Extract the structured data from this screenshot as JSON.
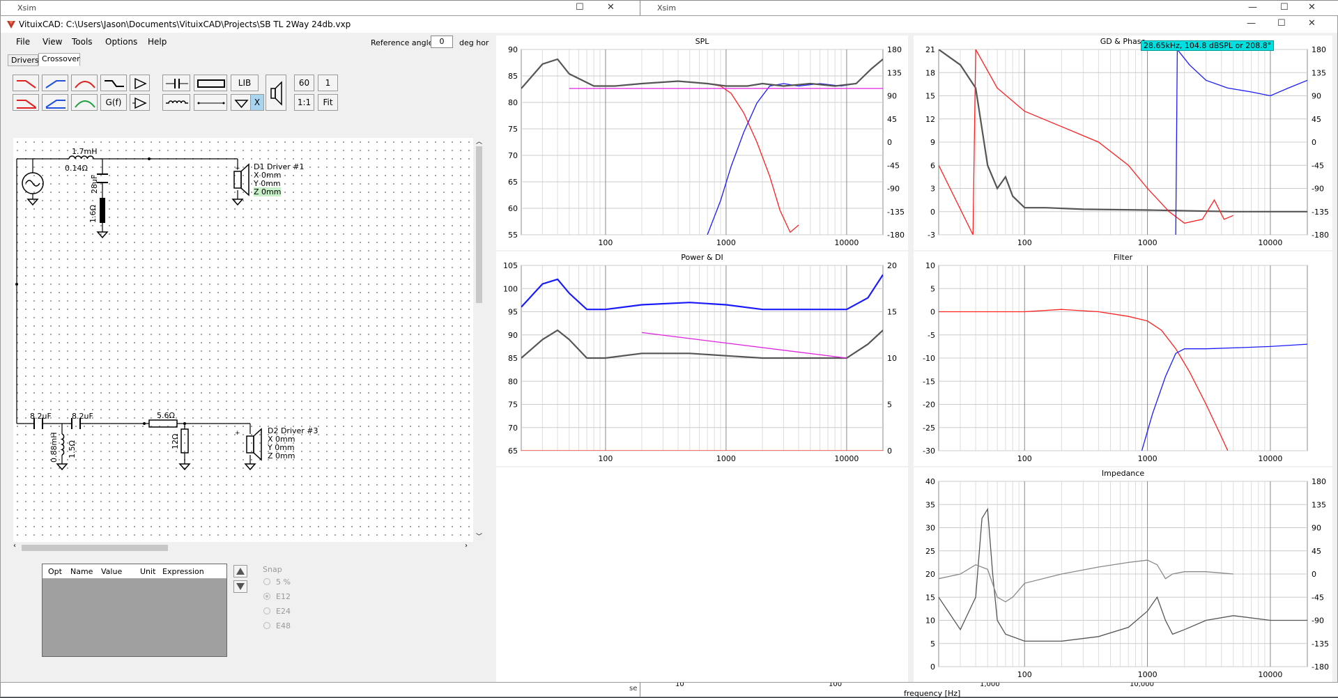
{
  "background_windows": {
    "left_title": "Xsim",
    "right_title": "Xsim",
    "bottom_axis_ticks": [
      "10",
      "100",
      "1,000",
      "10,000"
    ],
    "bottom_axis_label": "frequency [Hz]",
    "bottom_left_fragment": "se"
  },
  "app": {
    "title": "VituixCAD: C:\\Users\\Jason\\Documents\\VituixCAD\\Projects\\SB TL 2Way 24db.vxp",
    "menus": [
      "File",
      "View",
      "Tools",
      "Options",
      "Help"
    ],
    "reference_angle_label": "Reference angle",
    "reference_angle_value": "0",
    "reference_angle_unit": "deg hor",
    "tabs": [
      "Drivers",
      "Crossover"
    ],
    "active_tab": "Crossover"
  },
  "toolbar": {
    "lib": "LIB",
    "gf": "G(f)",
    "x": "X",
    "v60": "60",
    "v1": "1",
    "ratio": "1:1",
    "fit": "Fit"
  },
  "schematic": {
    "l1": "1.7mH",
    "l1_r": "0.14Ω",
    "c1": "28uF",
    "r1": "1.6Ω",
    "d1_name": "D1 Driver #1",
    "d1_x": "X 0mm",
    "d1_y": "Y 0mm",
    "d1_z": "Z 0mm",
    "c2": "8.2uF",
    "c3": "8.2uF",
    "l2": "0.88mH",
    "l2_r": "1.5Ω",
    "r2": "5.6Ω",
    "r3": "12Ω",
    "d2_name": "D2 Driver #3",
    "d2_x": "X 0mm",
    "d2_y": "Y 0mm",
    "d2_z": "Z 0mm"
  },
  "params_table": {
    "columns": [
      "Opt",
      "Name",
      "Value",
      "Unit",
      "Expression"
    ]
  },
  "snap": {
    "label": "Snap",
    "options": [
      "5 %",
      "E12",
      "E24",
      "E48"
    ],
    "selected": "E12"
  },
  "colors": {
    "woofer": "#ff2020",
    "tweeter": "#1a1aff",
    "sum": "#555555",
    "target": "#e020e0",
    "tooltip": "#00e0e0"
  },
  "chart_data": [
    {
      "type": "line",
      "title": "SPL",
      "x_scale": "log",
      "xlim": [
        20,
        20000
      ],
      "x_ticks": [
        "100",
        "1000",
        "10000"
      ],
      "ylim": [
        55,
        93
      ],
      "y_ticks": [
        "90",
        "85",
        "80",
        "75",
        "70",
        "65",
        "60",
        "55"
      ],
      "y2lim": [
        -180,
        180
      ],
      "y2_ticks": [
        "180",
        "135",
        "90",
        "45",
        "0",
        "-45",
        "-90",
        "-135",
        "-180"
      ],
      "series": [
        {
          "color": "#ff2020",
          "x": [
            20,
            30,
            40,
            50,
            80,
            120,
            200,
            400,
            700,
            900,
            1100,
            1400,
            1800,
            2300,
            2800,
            3400,
            4000
          ],
          "y": [
            85,
            90,
            91,
            88,
            85.5,
            85.5,
            86,
            86.5,
            86,
            85.5,
            84,
            80,
            74,
            67,
            60,
            55.5,
            57
          ]
        },
        {
          "color": "#1a1aff",
          "x": [
            700,
            900,
            1100,
            1400,
            1800,
            2300,
            3000,
            4000,
            6000,
            9000,
            12000,
            16000,
            20000
          ],
          "y": [
            55,
            62,
            69,
            76,
            82,
            85.5,
            86,
            85.5,
            86,
            85.5,
            86,
            89,
            91
          ]
        },
        {
          "color": "#555555",
          "x": [
            20,
            30,
            40,
            50,
            80,
            120,
            200,
            400,
            700,
            1000,
            1500,
            2000,
            3000,
            5000,
            8000,
            12000,
            16000,
            20000
          ],
          "y": [
            85,
            90,
            91,
            88,
            85.5,
            85.5,
            86,
            86.5,
            86,
            85.5,
            85.5,
            86,
            85.5,
            86,
            85.5,
            86,
            89,
            91
          ]
        },
        {
          "color": "#e020e0",
          "x": [
            50,
            20000
          ],
          "y": [
            85,
            85
          ]
        }
      ]
    },
    {
      "type": "line",
      "title": "GD & Phase",
      "x_scale": "log",
      "xlim": [
        20,
        20000
      ],
      "x_ticks": [
        "100",
        "1000",
        "10000"
      ],
      "ylim": [
        -3,
        21
      ],
      "y_ticks": [
        "21",
        "18",
        "15",
        "12",
        "9",
        "6",
        "3",
        "0",
        "-3"
      ],
      "y2lim": [
        -180,
        180
      ],
      "y2_ticks": [
        "180",
        "135",
        "90",
        "45",
        "0",
        "-45",
        "-90",
        "-135",
        "-180"
      ],
      "tooltip": "28.65kHz, 104.8 dBSPL or 208.8°",
      "series": [
        {
          "color": "#555555",
          "x": [
            20,
            30,
            40,
            50,
            60,
            70,
            80,
            100,
            150,
            300,
            1000,
            5000,
            20000
          ],
          "y": [
            21,
            19,
            16,
            6,
            3,
            4.5,
            2,
            0.5,
            0.5,
            0.3,
            0.2,
            0,
            0
          ]
        },
        {
          "color": "#ff2020",
          "x": [
            20,
            38,
            40,
            60,
            100,
            200,
            400,
            700,
            1000,
            1500,
            2000,
            2800,
            3500,
            4200,
            5000
          ],
          "y": [
            6,
            -3,
            21,
            16,
            13,
            11,
            9,
            6,
            3,
            0,
            -1.5,
            -1,
            1.5,
            -1,
            -0.5
          ]
        },
        {
          "color": "#1a1aff",
          "x": [
            1700,
            1750,
            2200,
            3000,
            4500,
            7000,
            10000,
            14000,
            20000
          ],
          "y": [
            -3,
            21,
            19,
            17,
            16,
            15.5,
            15,
            16,
            17
          ]
        }
      ]
    },
    {
      "type": "line",
      "title": "Power & DI",
      "x_scale": "log",
      "xlim": [
        20,
        20000
      ],
      "x_ticks": [
        "100",
        "1000",
        "10000"
      ],
      "ylim": [
        65,
        105
      ],
      "y_ticks": [
        "105",
        "100",
        "95",
        "90",
        "85",
        "80",
        "75",
        "70",
        "65"
      ],
      "y2lim": [
        0,
        20
      ],
      "y2_ticks": [
        "20",
        "15",
        "10",
        "5",
        "0"
      ],
      "series": [
        {
          "color": "#1a1aff",
          "x": [
            20,
            30,
            40,
            50,
            70,
            100,
            200,
            500,
            1000,
            2000,
            5000,
            10000,
            15000,
            20000
          ],
          "y": [
            96,
            101,
            102,
            99,
            95.5,
            95.5,
            96.5,
            97,
            96.5,
            95.5,
            95.5,
            95.5,
            98,
            103
          ]
        },
        {
          "color": "#555555",
          "x": [
            20,
            30,
            40,
            50,
            70,
            100,
            200,
            500,
            1000,
            2000,
            5000,
            10000,
            15000,
            20000
          ],
          "y": [
            85,
            89,
            91,
            89,
            85,
            85,
            86,
            86,
            85.5,
            85,
            85,
            85,
            88,
            91
          ]
        },
        {
          "color": "#e020e0",
          "x": [
            200,
            10000
          ],
          "y": [
            90.5,
            85
          ]
        },
        {
          "color": "#ff2020",
          "x": [
            20,
            20000
          ],
          "y": [
            65,
            65
          ]
        }
      ]
    },
    {
      "type": "line",
      "title": "Filter",
      "x_scale": "log",
      "xlim": [
        20,
        20000
      ],
      "x_ticks": [
        "100",
        "1000",
        "10000"
      ],
      "ylim": [
        -30,
        10
      ],
      "y_ticks": [
        "10",
        "5",
        "0",
        "-5",
        "-10",
        "-15",
        "-20",
        "-25",
        "-30"
      ],
      "series": [
        {
          "color": "#ff2020",
          "x": [
            20,
            100,
            200,
            400,
            700,
            1000,
            1300,
            1700,
            2200,
            3000,
            4000,
            4500
          ],
          "y": [
            0,
            0,
            0.5,
            0,
            -1,
            -2,
            -4,
            -8,
            -13,
            -20,
            -27,
            -30
          ]
        },
        {
          "color": "#1a1aff",
          "x": [
            900,
            1100,
            1400,
            1700,
            2000,
            3000,
            5000,
            10000,
            20000
          ],
          "y": [
            -30,
            -22,
            -14,
            -9,
            -8,
            -8,
            -7.8,
            -7.5,
            -7
          ]
        }
      ]
    },
    {
      "type": "line",
      "title": "Impedance",
      "x_scale": "log",
      "xlim": [
        20,
        20000
      ],
      "x_ticks": [
        "100",
        "1000",
        "10000"
      ],
      "ylim": [
        0,
        40
      ],
      "y_ticks": [
        "40",
        "35",
        "30",
        "25",
        "20",
        "15",
        "10",
        "5",
        "0"
      ],
      "y2lim": [
        -180,
        180
      ],
      "y2_ticks": [
        "180",
        "135",
        "90",
        "45",
        "0",
        "-45",
        "-90",
        "-135",
        "-180"
      ],
      "series": [
        {
          "color": "#555555",
          "x": [
            20,
            30,
            40,
            45,
            50,
            55,
            60,
            70,
            100,
            200,
            400,
            700,
            1000,
            1200,
            1400,
            1600,
            2000,
            3000,
            5000,
            10000,
            20000
          ],
          "y": [
            15,
            8,
            15,
            32,
            34,
            20,
            10,
            7,
            5.5,
            5.5,
            6.5,
            8.5,
            12,
            15,
            10,
            7,
            8,
            10,
            11,
            10,
            10
          ]
        },
        {
          "color": "#888888",
          "x": [
            20,
            30,
            40,
            50,
            60,
            70,
            80,
            100,
            200,
            400,
            700,
            1000,
            1200,
            1400,
            1600,
            2000,
            3000,
            5000
          ],
          "y": [
            19,
            20,
            22,
            21,
            15,
            14,
            15,
            18,
            20,
            21.5,
            22.5,
            23,
            22,
            19,
            20,
            20.5,
            20.5,
            20
          ]
        }
      ]
    }
  ]
}
